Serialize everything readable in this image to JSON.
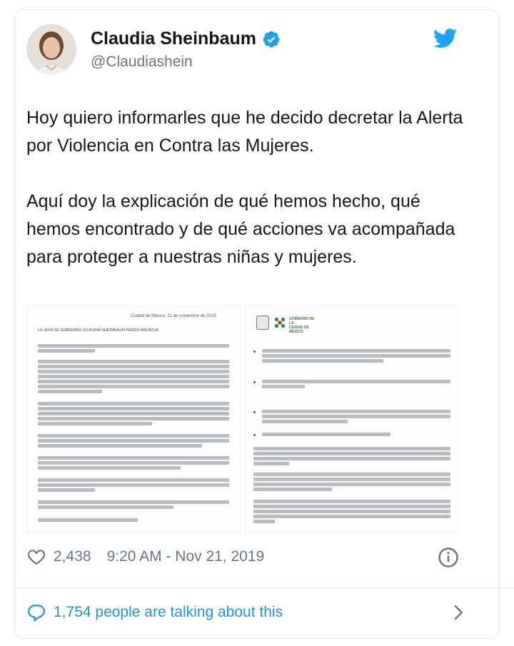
{
  "author": {
    "name": "Claudia Sheinbaum",
    "handle": "@Claudiashein",
    "verified": true
  },
  "tweet": {
    "paragraph1": "Hoy quiero informarles que he decido decretar la Alerta por Violencia en Contra las Mujeres.",
    "paragraph2": "Aquí doy la explicación de qué hemos hecho, qué hemos encontrado y de qué acciones va acompañada para proteger a nuestras niñas y mujeres."
  },
  "media": {
    "left_doc": {
      "date": "Ciudad de México, 21 de noviembre de 2019.",
      "heading": "LA JEFA DE GOBIERNO, CLAUDIA SHEINBAUM PARDO ANUNCIA:"
    },
    "right_doc": {
      "logo_line1": "GOBIERNO DE LA",
      "logo_line2": "CIUDAD DE MÉXICO"
    }
  },
  "meta": {
    "likes": "2,438",
    "timestamp": "9:20 AM - Nov 21, 2019"
  },
  "footer": {
    "talking": "1,754 people are talking about this"
  },
  "colors": {
    "brand_blue": "#1da1f2",
    "link_blue": "#1b95e0",
    "muted": "#657786",
    "text": "#14171a",
    "border": "#e1e8ed"
  },
  "icons": [
    "verified-badge-icon",
    "twitter-bird-icon",
    "heart-icon",
    "info-icon",
    "reply-bubble-icon",
    "chevron-right-icon"
  ]
}
